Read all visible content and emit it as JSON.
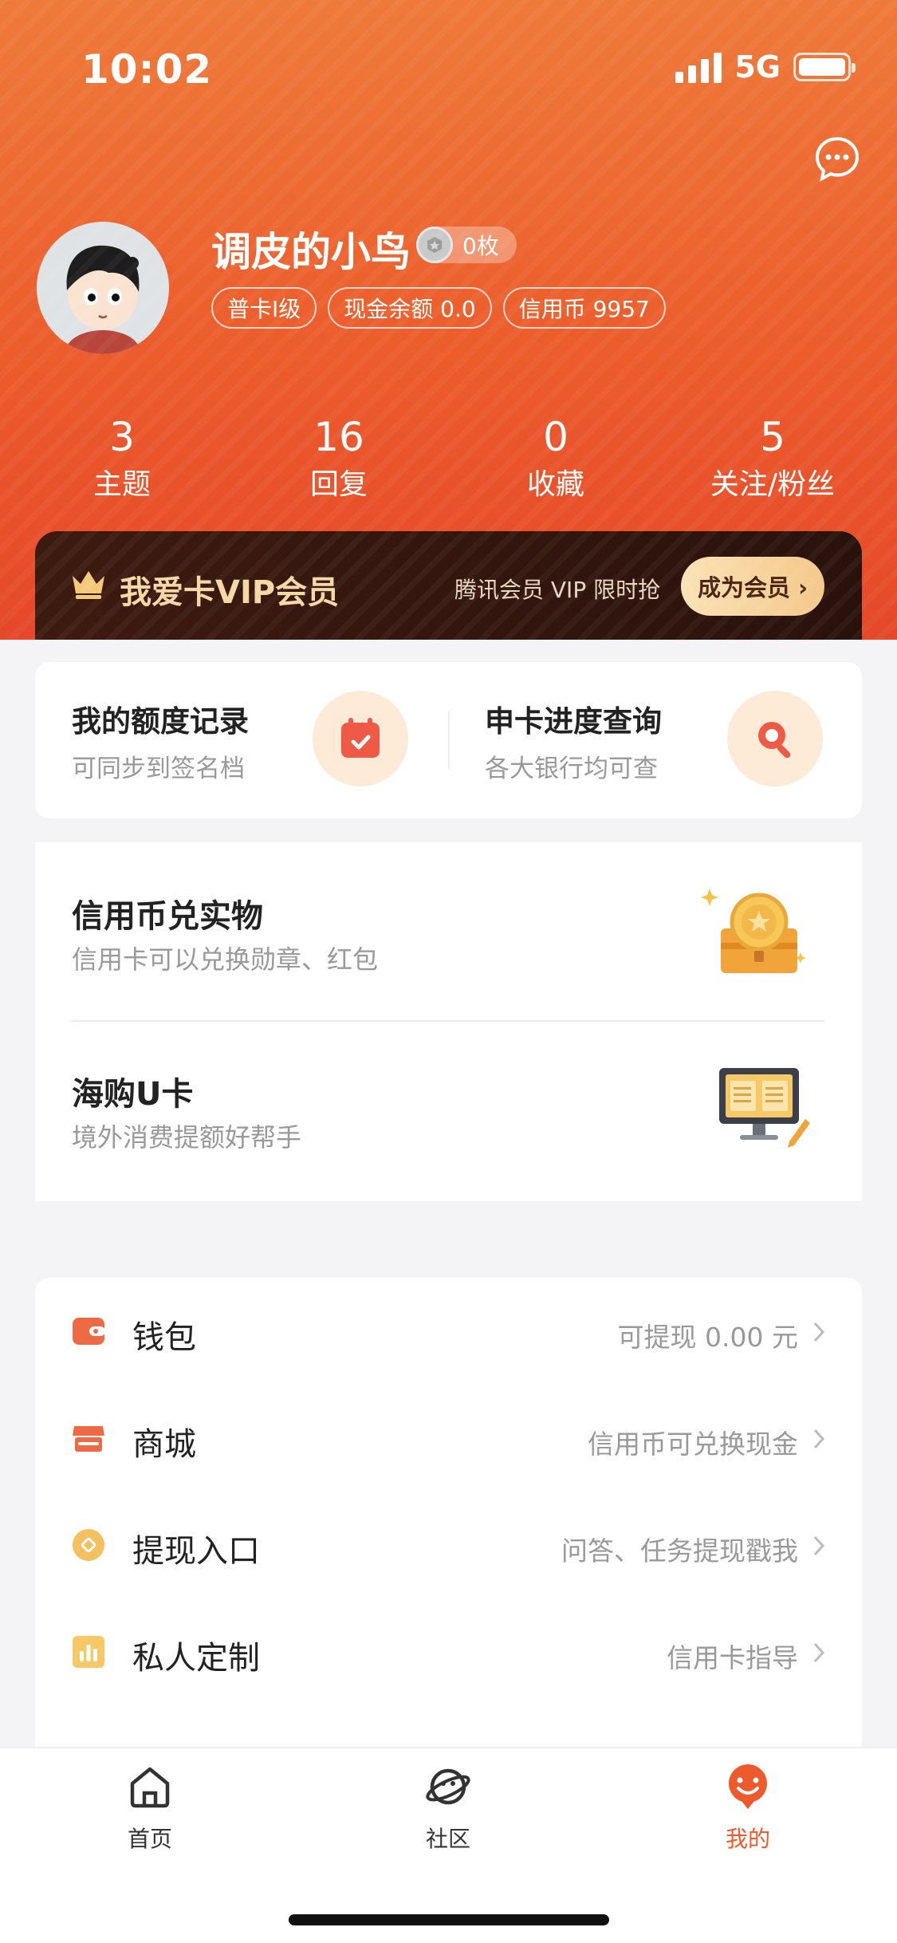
{
  "status_bar": {
    "time": "10:02",
    "network": "5G"
  },
  "profile": {
    "username": "调皮的小鸟",
    "coin_badge": "0枚",
    "tags": [
      "普卡I级",
      "现金余额 0.0",
      "信用币 9957"
    ]
  },
  "stats": [
    {
      "value": "3",
      "label": "主题"
    },
    {
      "value": "16",
      "label": "回复"
    },
    {
      "value": "0",
      "label": "收藏"
    },
    {
      "value": "5",
      "label": "关注/粉丝"
    }
  ],
  "vip": {
    "title": "我爱卡VIP会员",
    "promo": "腾讯会员 VIP 限时抢",
    "button": "成为会员 ›"
  },
  "quick_actions": [
    {
      "title": "我的额度记录",
      "subtitle": "可同步到签名档",
      "icon": "calendar-check-icon"
    },
    {
      "title": "申卡进度查询",
      "subtitle": "各大银行均可查",
      "icon": "magnifier-icon"
    }
  ],
  "features": [
    {
      "title": "信用币兑实物",
      "subtitle": "信用卡可以兑换勋章、红包",
      "icon": "treasure-chest-icon"
    },
    {
      "title": "海购U卡",
      "subtitle": "境外消费提额好帮手",
      "icon": "monitor-card-icon"
    }
  ],
  "menu": [
    {
      "label": "钱包",
      "value": "可提现 0.00 元",
      "icon": "wallet-icon"
    },
    {
      "label": "商城",
      "value": "信用币可兑换现金",
      "icon": "shop-icon"
    },
    {
      "label": "提现入口",
      "value": "问答、任务提现戳我",
      "icon": "coin-icon"
    },
    {
      "label": "私人定制",
      "value": "信用卡指导",
      "icon": "chart-icon"
    }
  ],
  "tabbar": [
    {
      "label": "首页",
      "icon": "home-icon",
      "active": false
    },
    {
      "label": "社区",
      "icon": "planet-icon",
      "active": false
    },
    {
      "label": "我的",
      "icon": "profile-icon",
      "active": true
    }
  ],
  "colors": {
    "accent": "#ee5a2b",
    "vip_gold": "#f5d8a6",
    "vip_bg": "#2a120c"
  }
}
